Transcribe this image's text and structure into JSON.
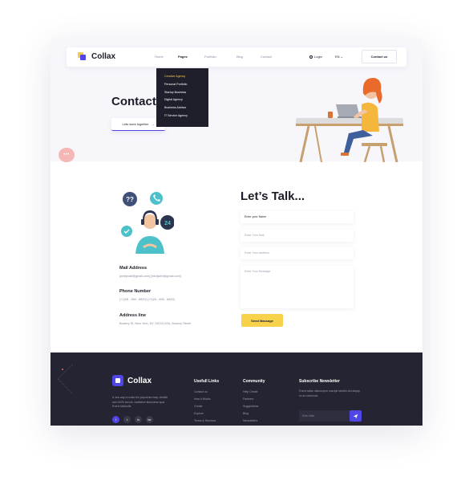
{
  "header": {
    "brand": "Collax",
    "nav": [
      "Home",
      "Pages",
      "Portfolio",
      "Blog",
      "Contact"
    ],
    "active_nav": "Pages",
    "login_label": "Login",
    "lang_label": "EN ⌄",
    "contact_button": "Contact us"
  },
  "dropdown": {
    "items": [
      "Creative Agency",
      "Personal Portfolio",
      "Startup Business",
      "Digital Agency",
      "Business Advisor",
      "IT Service Agency"
    ],
    "active_item": "Creative Agency"
  },
  "hero": {
    "title": "Contact",
    "button_label": "Lets work together",
    "button_arrow": "→",
    "chat_label": "•••"
  },
  "contact_info": {
    "mail_title": "Mail Address",
    "mail_value": "[web]mail@gmail.com]       [info]web@gmail.com]",
    "phone_title": "Phone Number",
    "phone_value": "(+1)26 - 569 - 8820)    (+1)26 - 895 - 8820)",
    "address_title": "Address line",
    "address_value": "Bowery St, New York, NY 10013,USA, Bowery Street"
  },
  "form": {
    "title": "Let’s Talk...",
    "name_placeholder": "Enter your Name",
    "mail_placeholder": "Enter Your Mail",
    "address_placeholder": "Enter Your Address",
    "message_placeholder": "Enter Your Message",
    "send_label": "Send Massage"
  },
  "illustration": {
    "question_label": "??",
    "clock_label": "24"
  },
  "footer": {
    "brand": "Collax",
    "description": "A new way to make the payments easy, reliable and 100% secure. claritatem itamconse quat. Exerci tationulla",
    "socials": [
      "f",
      "t",
      "in",
      "be"
    ],
    "useful_title": "Usefull Links",
    "useful_links": [
      "Contact us",
      "How it Works",
      "Create",
      "Explore",
      "Terms & Services"
    ],
    "community_title": "Community",
    "community_links": [
      "Help Center",
      "Partners",
      "Suggestions",
      "Blog",
      "Newsletters"
    ],
    "newsletter_title": "Subscribe Newsletter",
    "newsletter_text": "Exerci tation ullamcorper suscipit lobortis nisl aliquip ex ea commodo",
    "newsletter_placeholder": "Enter Mail"
  },
  "colors": {
    "accent": "#4f46e5",
    "yellow": "#f7d24a",
    "dark": "#242432"
  }
}
